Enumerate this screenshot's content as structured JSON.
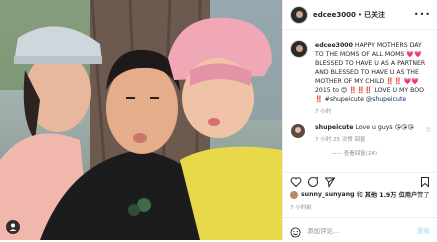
{
  "post": {
    "username": "edcee3000",
    "follow_label": "已关注",
    "caption": "HAPPY MOTHERS DAY TO THE MOMS OF ALL MOMS 💗💗 BLESSED TO HAVE U AS A PARTNER AND BLESSED TO HAVE U AS THE MOTHER OF MY CHILD ‼️‼️ 💗💗 2015 to 😍 ‼️‼️‼️ LOVE U MY BOO ‼️ #shupeicute",
    "caption_mention": "@shupeicute",
    "caption_meta": "7 小时",
    "comment": {
      "username": "shupeicute",
      "text": "Love u guys 😘😘😘",
      "meta": "7 小时   25 次赞   回复"
    },
    "replies_label": "—— 查看回复(24)",
    "likes": {
      "user": "sunny_sunyang",
      "and": "和",
      "others": "其他 1.9万 位用户",
      "suffix": "赞了"
    },
    "time_ago": "7 小时前",
    "comment_placeholder": "添加评论...",
    "post_button": "发布"
  }
}
